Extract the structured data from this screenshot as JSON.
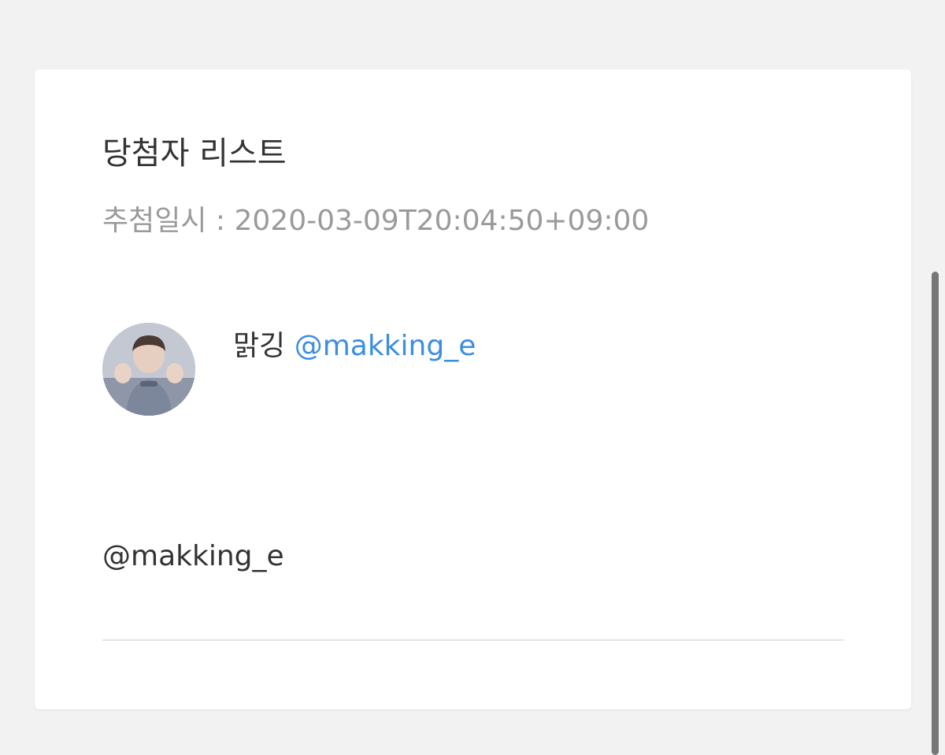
{
  "card": {
    "title": "당첨자 리스트",
    "draw_time": "추첨일시 : 2020-03-09T20:04:50+09:00"
  },
  "winner": {
    "name": "맑깅",
    "handle": "@makking_e",
    "avatar_icon": "profile-photo"
  },
  "entry": {
    "text": "@makking_e"
  },
  "colors": {
    "background": "#f2f2f2",
    "card": "#ffffff",
    "handle_link": "#3b8ee2",
    "muted_text": "#9a9a9a",
    "scrollbar": "#777777"
  }
}
